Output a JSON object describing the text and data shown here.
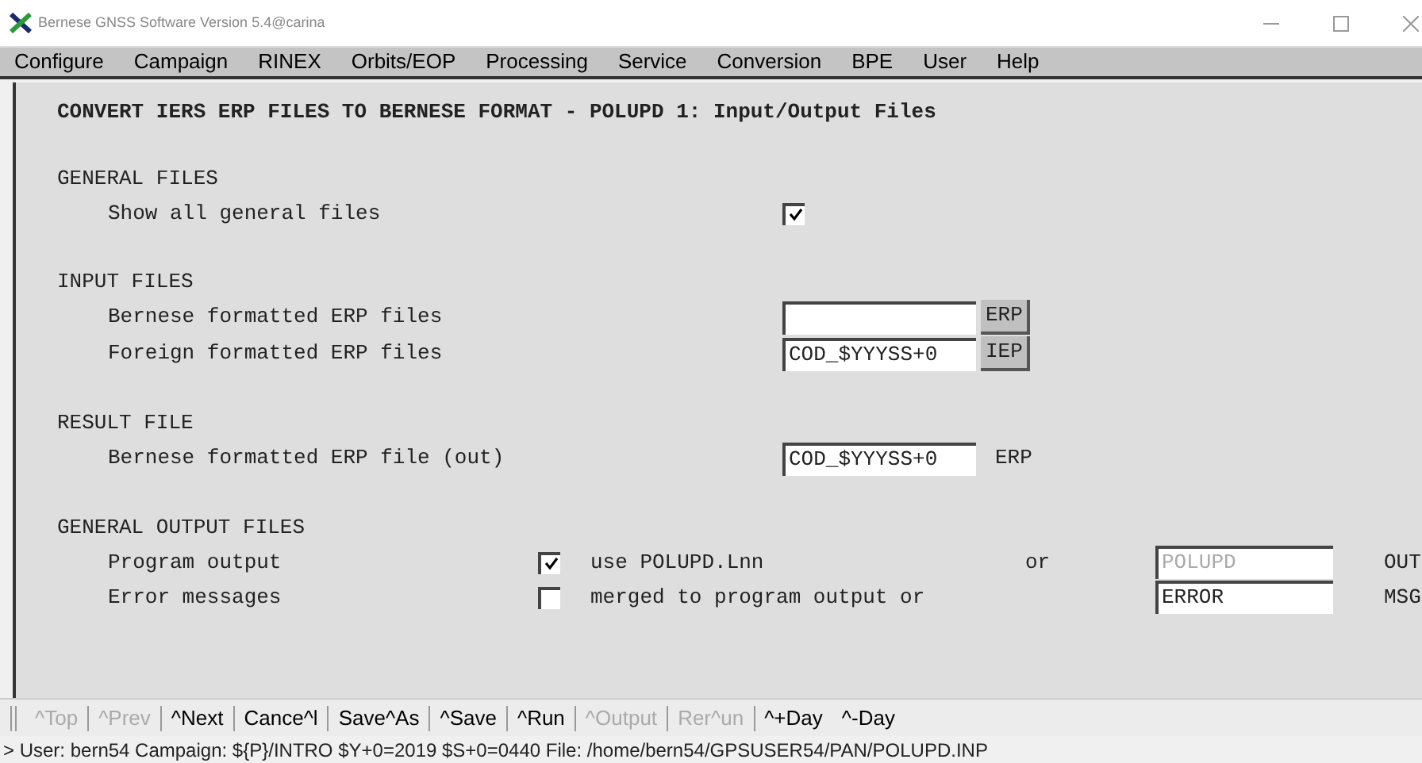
{
  "window": {
    "title": "Bernese GNSS Software Version 5.4@carina"
  },
  "menu": [
    "Configure",
    "Campaign",
    "RINEX",
    "Orbits/EOP",
    "Processing",
    "Service",
    "Conversion",
    "BPE",
    "User",
    "Help"
  ],
  "panel_title": "CONVERT IERS ERP FILES TO BERNESE FORMAT - POLUPD 1: Input/Output Files",
  "sections": [
    {
      "heading": "GENERAL FILES",
      "rows": [
        {
          "kind": "checkbox",
          "label": "Show all general files",
          "checked": true
        }
      ]
    },
    {
      "heading": "INPUT FILES",
      "rows": [
        {
          "kind": "file_select",
          "label": "Bernese formatted ERP files",
          "value": "",
          "extension": "ERP"
        },
        {
          "kind": "file_select",
          "label": "Foreign formatted ERP files",
          "value": "COD_$YYYSS+0",
          "extension": "IEP"
        }
      ]
    },
    {
      "heading": "RESULT FILE",
      "rows": [
        {
          "kind": "file_output",
          "label": "Bernese formatted ERP file (out)",
          "value": "COD_$YYYSS+0",
          "extension": "ERP"
        }
      ]
    },
    {
      "heading": "GENERAL OUTPUT FILES",
      "rows": [
        {
          "kind": "output_option",
          "label": "Program output",
          "checked": true,
          "option": "use POLUPD.Lnn",
          "or": "or",
          "value": "POLUPD",
          "disabled": true,
          "extension": "OUT"
        },
        {
          "kind": "output_option",
          "label": "Error messages",
          "checked": false,
          "option": "merged to program output or",
          "or": "",
          "value": "ERROR",
          "disabled": false,
          "extension": "MSG"
        }
      ]
    }
  ],
  "buttons": [
    {
      "label": "^Top",
      "disabled": true
    },
    {
      "label": "^Prev",
      "disabled": true
    },
    {
      "label": "^Next",
      "disabled": false
    },
    {
      "label": "Cance^l",
      "disabled": false
    },
    {
      "label": "Save^As",
      "disabled": false
    },
    {
      "label": "^Save",
      "disabled": false
    },
    {
      "label": "^Run",
      "disabled": false
    },
    {
      "label": "^Output",
      "disabled": true
    },
    {
      "label": "Rer^un",
      "disabled": true
    },
    {
      "label": "^+Day",
      "disabled": false
    },
    {
      "label": "^-Day",
      "disabled": false
    }
  ],
  "status_bar": "> User: bern54  Campaign: ${P}/INTRO  $Y+0=2019  $S+0=0440  File: /home/bern54/GPSUSER54/PAN/POLUPD.INP"
}
